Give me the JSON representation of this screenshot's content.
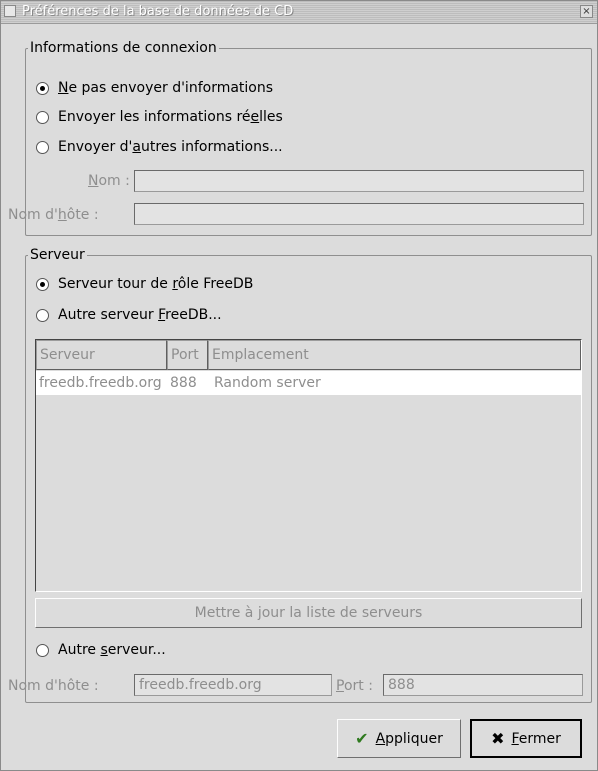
{
  "window": {
    "title": "Préférences de la base de données de CD"
  },
  "connection": {
    "legend": "Informations de connexion",
    "options": [
      {
        "label": "Ne pas envoyer d'informations",
        "selected": true
      },
      {
        "label": "Envoyer les informations réelles",
        "selected": false
      },
      {
        "label": "Envoyer d'autres informations...",
        "selected": false
      }
    ],
    "name_label": "Nom :",
    "name_value": "",
    "host_label": "Nom d'hôte :",
    "host_value": ""
  },
  "server": {
    "legend": "Serveur",
    "options": [
      {
        "label": "Serveur tour de rôle FreeDB",
        "selected": true
      },
      {
        "label": "Autre serveur FreeDB...",
        "selected": false
      }
    ],
    "columns": [
      "Serveur",
      "Port",
      "Emplacement"
    ],
    "rows": [
      [
        "freedb.freedb.org",
        "888",
        "Random server"
      ]
    ],
    "update_button": "Mettre à jour la liste de serveurs",
    "other_server_option": {
      "label": "Autre serveur...",
      "selected": false
    },
    "host_label": "Nom d'hôte :",
    "host_value": "freedb.freedb.org",
    "port_label": "Port :",
    "port_value": "888"
  },
  "buttons": {
    "apply": "Appliquer",
    "close": "Fermer"
  }
}
